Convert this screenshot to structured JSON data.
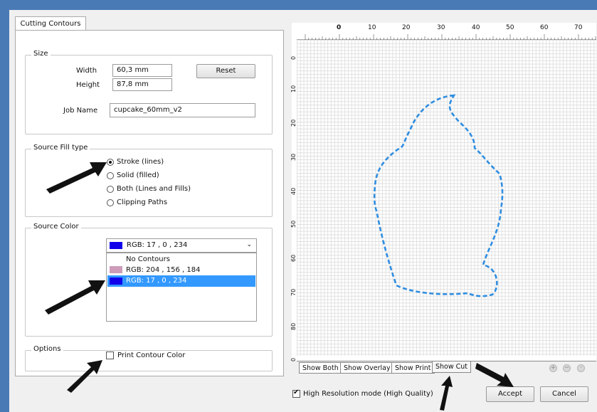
{
  "dialog": {
    "tab_label": "Cutting Contours"
  },
  "size": {
    "title": "Size",
    "width_label": "Width",
    "width_value": "60,3 mm",
    "height_label": "Height",
    "height_value": "87,8 mm",
    "reset_label": "Reset",
    "job_name_label": "Job Name",
    "job_name_value": "cupcake_60mm_v2"
  },
  "fill_type": {
    "title": "Source Fill type",
    "options": [
      "Stroke (lines)",
      "Solid (filled)",
      "Both (Lines and Fills)",
      "Clipping Paths"
    ],
    "selected_index": 0
  },
  "source_color": {
    "title": "Source Color",
    "selected": "RGB:  17 , 0 , 234",
    "items": [
      {
        "label": "No Contours",
        "swatch": ""
      },
      {
        "label": "RGB:  204 , 156 , 184",
        "swatch": "#cc9cb8"
      },
      {
        "label": "RGB:  17 , 0 , 234",
        "swatch": "#1100ea"
      }
    ],
    "selected_color": "#1100ea"
  },
  "options": {
    "title": "Options",
    "print_contour_label": "Print Contour Color",
    "print_contour_checked": false
  },
  "ruler": {
    "top_labels": [
      "0",
      "10",
      "20",
      "30",
      "40",
      "50",
      "60",
      "70"
    ],
    "left_labels": [
      "0",
      "10",
      "20",
      "30",
      "40",
      "50",
      "60",
      "70",
      "80",
      "0"
    ]
  },
  "view_tabs": [
    "Show Both",
    "Show Overlay",
    "Show Print",
    "Show Cut"
  ],
  "active_view_tab": "Show Cut",
  "high_res": {
    "label": "High Resolution mode (High Quality)",
    "checked": true
  },
  "buttons": {
    "accept": "Accept",
    "cancel": "Cancel"
  },
  "colors": {
    "contour": "#2f8de0",
    "selection": "#3399ff",
    "window_frame": "#4a7ab5"
  }
}
